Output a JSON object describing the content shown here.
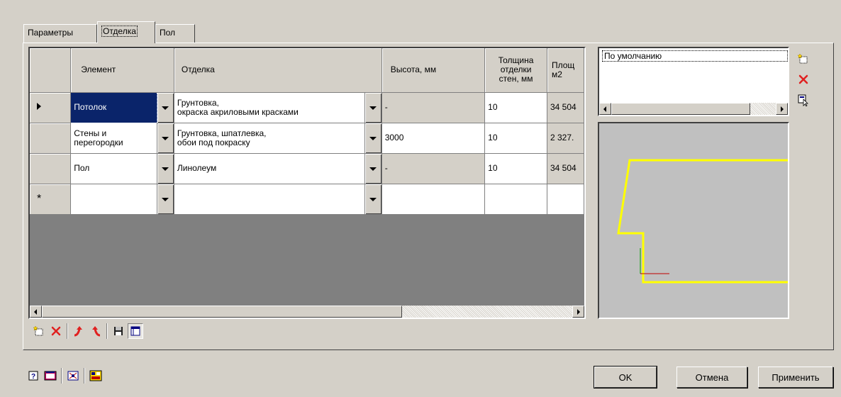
{
  "tabs": [
    {
      "label": "Параметры"
    },
    {
      "label": "Отделка"
    },
    {
      "label": "Пол"
    }
  ],
  "grid": {
    "columns": [
      "Элемент",
      "Отделка",
      "Высота, мм",
      "Толщина\nотделки\nстен, мм",
      "Площ\nм2"
    ],
    "rows": [
      {
        "element": "Потолок",
        "finish": "Грунтовка,\nокраска акриловыми красками",
        "height": "-",
        "thickness": "10",
        "area": "34 504",
        "current": true
      },
      {
        "element": "Стены и\nперегородки",
        "finish": "Грунтовка, шпатлевка,\nобои под покраску",
        "height": "3000",
        "thickness": "10",
        "area": "2 327.",
        "current": false
      },
      {
        "element": "Пол",
        "finish": "Линолеум",
        "height": "-",
        "thickness": "10",
        "area": "34 504",
        "current": false
      }
    ],
    "new_row_marker": "*"
  },
  "styles_list": {
    "items": [
      "По умолчанию"
    ]
  },
  "buttons": {
    "ok": "OK",
    "cancel": "Отмена",
    "apply": "Применить"
  },
  "colors": {
    "outline": "#ffff00",
    "axis_x": "#c00000",
    "axis_y": "#00a000",
    "selection": "#0a246a"
  }
}
